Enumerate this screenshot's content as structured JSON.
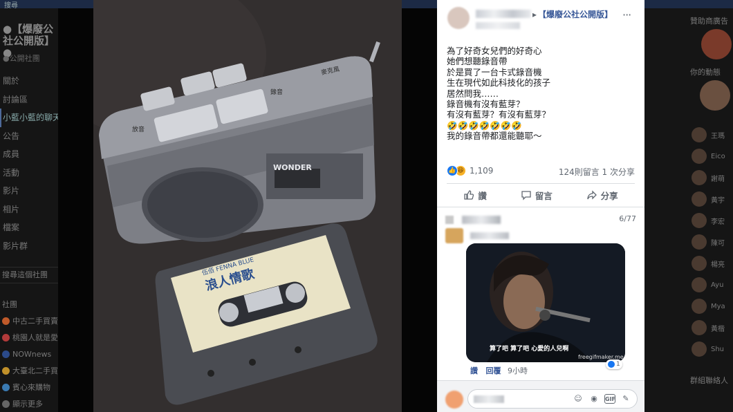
{
  "background": {
    "topbar_label": "搜尋",
    "left": {
      "group_title": "●【爆廢公社公開版】●",
      "group_privacy": "●公開社團",
      "nav": [
        "關於",
        "討論區",
        "小藍小藍的聊天室",
        "公告",
        "成員",
        "活動",
        "影片",
        "相片",
        "檔案",
        "影片群"
      ],
      "active_index": 2,
      "search_label": "搜尋這個社團",
      "groups_title": "社團",
      "groups": [
        {
          "label": "中古二手買賣",
          "color": "#c05a2a"
        },
        {
          "label": "桃園人就是愛",
          "color": "#b23a3a"
        },
        {
          "label": "NOWnews",
          "color": "#2b4a8a"
        },
        {
          "label": "大臺北二手買賣",
          "color": "#c0902a"
        },
        {
          "label": "賓心來購物",
          "color": "#3a7ab2"
        },
        {
          "label": "顯示更多",
          "color": "#666666"
        }
      ]
    },
    "right": {
      "ad_title": "贊助商廣告",
      "online_title": "你的動態",
      "contacts": [
        "王瑪",
        "Eico",
        "謝萌",
        "黃宇",
        "李宏",
        "陳可",
        "楊亮",
        "Ayu",
        "Mya",
        "黃楷",
        "Shu"
      ],
      "footer": "群組聯絡人"
    }
  },
  "post": {
    "group_name": "【爆廢公社公開版】",
    "more_label": "···",
    "text_lines": [
      "為了好奇女兒們的好奇心",
      "她們想聽錄音帶",
      "於是買了一台卡式錄音機",
      "生在現代如此科技化的孩子",
      "居然問我……",
      "錄音機有沒有藍芽？",
      "有沒有藍芽？有沒有藍芽？",
      "🤣🤣🤣🤣🤣🤣🤣",
      "我的錄音帶都還能聽耶～"
    ],
    "reaction_count": "1,109",
    "reaction_right": "124則留言  1 次分享",
    "actions": {
      "like": "讚",
      "comment": "留言",
      "share": "分享"
    }
  },
  "comment": {
    "count_label": "6/77",
    "gif_caption": "算了吧   算了吧   心愛的人兒啊",
    "gif_watermark": "freegifmaker.me",
    "gif_reaction_count": "1",
    "like_label": "讚",
    "reply_label": "回覆",
    "time": "9小時"
  },
  "photo": {
    "brand": "WONDER",
    "cassette_label": "浪人情歌",
    "cassette_series": "伍佰 FENNA BLUE",
    "player_side_label": "放音",
    "player_record_label": "錄音",
    "player_mic_label": "麥克風"
  },
  "composer": {
    "icons": [
      "emoji-icon",
      "camera-icon",
      "gif-icon",
      "sticker-icon"
    ]
  }
}
